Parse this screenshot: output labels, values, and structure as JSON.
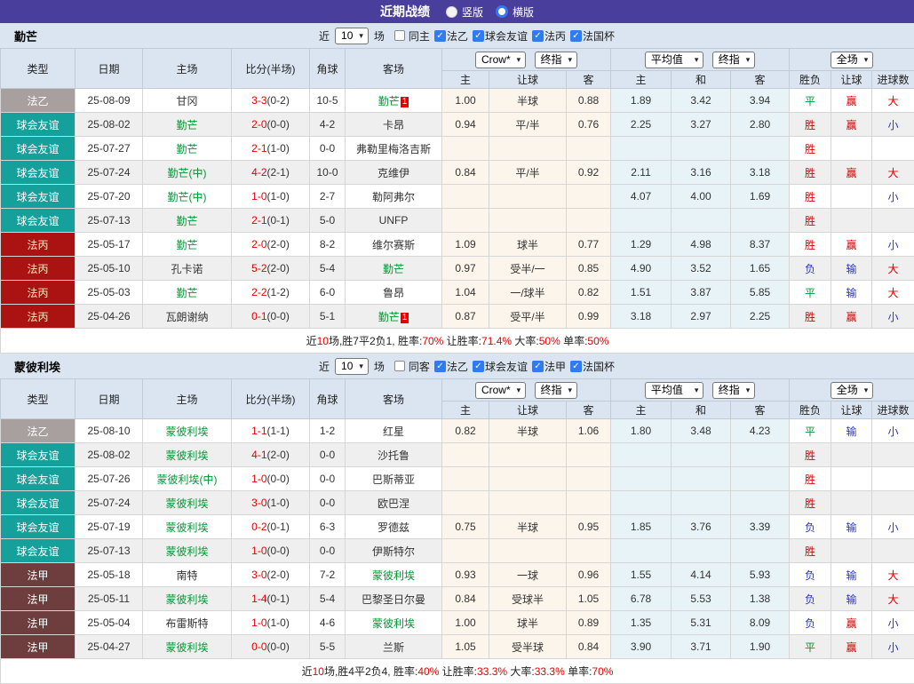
{
  "titlebar": {
    "title": "近期战绩",
    "radios": [
      {
        "label": "竖版",
        "checked": false
      },
      {
        "label": "横版",
        "checked": true
      }
    ]
  },
  "common": {
    "near_label": "近",
    "count_value": "10",
    "matches_label": "场",
    "col_headers": [
      "类型",
      "日期",
      "主场",
      "比分(半场)",
      "角球",
      "客场"
    ],
    "odds_select1": "Crow*",
    "odds_select2": "终指",
    "avg_select1": "平均值",
    "avg_select2": "终指",
    "scope_select": "全场",
    "sub_headers": [
      "主",
      "让球",
      "客",
      "主",
      "和",
      "客",
      "胜负",
      "让球",
      "进球数"
    ]
  },
  "league_colors": {
    "法乙": {
      "bg": "#a89f9f",
      "fg": "#ffffff"
    },
    "球会友谊": {
      "bg": "#16a09c",
      "fg": "#ffffff"
    },
    "法丙": {
      "bg": "#ab1212",
      "fg": "#ffe9c0"
    },
    "法甲": {
      "bg": "#6e3d3d",
      "fg": "#ffffff"
    }
  },
  "sections": [
    {
      "team": "勤芒",
      "same_venue_label": "同主",
      "leagues": [
        "法乙",
        "球会友谊",
        "法丙",
        "法国杯"
      ],
      "rows": [
        {
          "league": "法乙",
          "date": "25-08-09",
          "home": "甘冈",
          "home_green": false,
          "score": "3-3",
          "half": "(0-2)",
          "corner": "10-5",
          "away": "勤芒",
          "away_green": true,
          "away_badge": "1",
          "odds": [
            "1.00",
            "半球",
            "0.88"
          ],
          "avg": [
            "1.89",
            "3.42",
            "3.94"
          ],
          "results": [
            [
              "平",
              "g"
            ],
            [
              "赢",
              "r"
            ],
            [
              "大",
              "r"
            ]
          ]
        },
        {
          "league": "球会友谊",
          "date": "25-08-02",
          "home": "勤芒",
          "home_green": true,
          "score": "2-0",
          "half": "(0-0)",
          "corner": "4-2",
          "away": "卡昂",
          "away_green": false,
          "away_badge": "",
          "odds": [
            "0.94",
            "平/半",
            "0.76"
          ],
          "avg": [
            "2.25",
            "3.27",
            "2.80"
          ],
          "results": [
            [
              "胜",
              "r"
            ],
            [
              "赢",
              "r"
            ],
            [
              "小",
              "b"
            ]
          ]
        },
        {
          "league": "球会友谊",
          "date": "25-07-27",
          "home": "勤芒",
          "home_green": true,
          "score": "2-1",
          "half": "(1-0)",
          "corner": "0-0",
          "away": "弗勒里梅洛吉斯",
          "away_green": false,
          "away_badge": "",
          "odds": [
            "",
            "",
            ""
          ],
          "avg": [
            "",
            "",
            ""
          ],
          "results": [
            [
              "胜",
              "r"
            ],
            [
              "",
              ""
            ],
            [
              "",
              ""
            ]
          ]
        },
        {
          "league": "球会友谊",
          "date": "25-07-24",
          "home": "勤芒(中)",
          "home_green": true,
          "score": "4-2",
          "half": "(2-1)",
          "corner": "10-0",
          "away": "克维伊",
          "away_green": false,
          "away_badge": "",
          "odds": [
            "0.84",
            "平/半",
            "0.92"
          ],
          "avg": [
            "2.11",
            "3.16",
            "3.18"
          ],
          "results": [
            [
              "胜",
              "r"
            ],
            [
              "赢",
              "r"
            ],
            [
              "大",
              "r"
            ]
          ]
        },
        {
          "league": "球会友谊",
          "date": "25-07-20",
          "home": "勤芒(中)",
          "home_green": true,
          "score": "1-0",
          "half": "(1-0)",
          "corner": "2-7",
          "away": "勒阿弗尔",
          "away_green": false,
          "away_badge": "",
          "odds": [
            "",
            "",
            ""
          ],
          "avg": [
            "4.07",
            "4.00",
            "1.69"
          ],
          "results": [
            [
              "胜",
              "r"
            ],
            [
              "",
              ""
            ],
            [
              "小",
              "b"
            ]
          ]
        },
        {
          "league": "球会友谊",
          "date": "25-07-13",
          "home": "勤芒",
          "home_green": true,
          "score": "2-1",
          "half": "(0-1)",
          "corner": "5-0",
          "away": "UNFP",
          "away_green": false,
          "away_badge": "",
          "odds": [
            "",
            "",
            ""
          ],
          "avg": [
            "",
            "",
            ""
          ],
          "results": [
            [
              "胜",
              "r"
            ],
            [
              "",
              ""
            ],
            [
              "",
              ""
            ]
          ]
        },
        {
          "league": "法丙",
          "date": "25-05-17",
          "home": "勤芒",
          "home_green": true,
          "score": "2-0",
          "half": "(2-0)",
          "corner": "8-2",
          "away": "维尔赛斯",
          "away_green": false,
          "away_badge": "",
          "odds": [
            "1.09",
            "球半",
            "0.77"
          ],
          "avg": [
            "1.29",
            "4.98",
            "8.37"
          ],
          "results": [
            [
              "胜",
              "r"
            ],
            [
              "赢",
              "r"
            ],
            [
              "小",
              "b"
            ]
          ]
        },
        {
          "league": "法丙",
          "date": "25-05-10",
          "home": "孔卡诺",
          "home_green": false,
          "score": "5-2",
          "half": "(2-0)",
          "corner": "5-4",
          "away": "勤芒",
          "away_green": true,
          "away_badge": "",
          "odds": [
            "0.97",
            "受半/一",
            "0.85"
          ],
          "avg": [
            "4.90",
            "3.52",
            "1.65"
          ],
          "results": [
            [
              "负",
              "b"
            ],
            [
              "输",
              "b"
            ],
            [
              "大",
              "r"
            ]
          ]
        },
        {
          "league": "法丙",
          "date": "25-05-03",
          "home": "勤芒",
          "home_green": true,
          "score": "2-2",
          "half": "(1-2)",
          "corner": "6-0",
          "away": "鲁昂",
          "away_green": false,
          "away_badge": "",
          "odds": [
            "1.04",
            "一/球半",
            "0.82"
          ],
          "avg": [
            "1.51",
            "3.87",
            "5.85"
          ],
          "results": [
            [
              "平",
              "g"
            ],
            [
              "输",
              "b"
            ],
            [
              "大",
              "r"
            ]
          ]
        },
        {
          "league": "法丙",
          "date": "25-04-26",
          "home": "瓦朗谢纳",
          "home_green": false,
          "score": "0-1",
          "half": "(0-0)",
          "corner": "5-1",
          "away": "勤芒",
          "away_green": true,
          "away_badge": "1",
          "odds": [
            "0.87",
            "受平/半",
            "0.99"
          ],
          "avg": [
            "3.18",
            "2.97",
            "2.25"
          ],
          "results": [
            [
              "胜",
              "r"
            ],
            [
              "赢",
              "r"
            ],
            [
              "小",
              "b"
            ]
          ]
        }
      ],
      "summary": [
        {
          "t": "近",
          "r": false
        },
        {
          "t": "10",
          "r": true
        },
        {
          "t": "场,胜7平2负1, 胜率:",
          "r": false
        },
        {
          "t": "70%",
          "r": true
        },
        {
          "t": " 让胜率:",
          "r": false
        },
        {
          "t": "71.4%",
          "r": true
        },
        {
          "t": " 大率:",
          "r": false
        },
        {
          "t": "50%",
          "r": true
        },
        {
          "t": " 单率:",
          "r": false
        },
        {
          "t": "50%",
          "r": true
        }
      ]
    },
    {
      "team": "蒙彼利埃",
      "same_venue_label": "同客",
      "leagues": [
        "法乙",
        "球会友谊",
        "法甲",
        "法国杯"
      ],
      "rows": [
        {
          "league": "法乙",
          "date": "25-08-10",
          "home": "蒙彼利埃",
          "home_green": true,
          "score": "1-1",
          "half": "(1-1)",
          "corner": "1-2",
          "away": "红星",
          "away_green": false,
          "away_badge": "",
          "odds": [
            "0.82",
            "半球",
            "1.06"
          ],
          "avg": [
            "1.80",
            "3.48",
            "4.23"
          ],
          "results": [
            [
              "平",
              "g"
            ],
            [
              "输",
              "b"
            ],
            [
              "小",
              "b"
            ]
          ]
        },
        {
          "league": "球会友谊",
          "date": "25-08-02",
          "home": "蒙彼利埃",
          "home_green": true,
          "score": "4-1",
          "half": "(2-0)",
          "corner": "0-0",
          "away": "沙托鲁",
          "away_green": false,
          "away_badge": "",
          "odds": [
            "",
            "",
            ""
          ],
          "avg": [
            "",
            "",
            ""
          ],
          "results": [
            [
              "胜",
              "r"
            ],
            [
              "",
              ""
            ],
            [
              "",
              ""
            ]
          ]
        },
        {
          "league": "球会友谊",
          "date": "25-07-26",
          "home": "蒙彼利埃(中)",
          "home_green": true,
          "score": "1-0",
          "half": "(0-0)",
          "corner": "0-0",
          "away": "巴斯蒂亚",
          "away_green": false,
          "away_badge": "",
          "odds": [
            "",
            "",
            ""
          ],
          "avg": [
            "",
            "",
            ""
          ],
          "results": [
            [
              "胜",
              "r"
            ],
            [
              "",
              ""
            ],
            [
              "",
              ""
            ]
          ]
        },
        {
          "league": "球会友谊",
          "date": "25-07-24",
          "home": "蒙彼利埃",
          "home_green": true,
          "score": "3-0",
          "half": "(1-0)",
          "corner": "0-0",
          "away": "欧巴涅",
          "away_green": false,
          "away_badge": "",
          "odds": [
            "",
            "",
            ""
          ],
          "avg": [
            "",
            "",
            ""
          ],
          "results": [
            [
              "胜",
              "r"
            ],
            [
              "",
              ""
            ],
            [
              "",
              ""
            ]
          ]
        },
        {
          "league": "球会友谊",
          "date": "25-07-19",
          "home": "蒙彼利埃",
          "home_green": true,
          "score": "0-2",
          "half": "(0-1)",
          "corner": "6-3",
          "away": "罗德兹",
          "away_green": false,
          "away_badge": "",
          "odds": [
            "0.75",
            "半球",
            "0.95"
          ],
          "avg": [
            "1.85",
            "3.76",
            "3.39"
          ],
          "results": [
            [
              "负",
              "b"
            ],
            [
              "输",
              "b"
            ],
            [
              "小",
              "b"
            ]
          ]
        },
        {
          "league": "球会友谊",
          "date": "25-07-13",
          "home": "蒙彼利埃",
          "home_green": true,
          "score": "1-0",
          "half": "(0-0)",
          "corner": "0-0",
          "away": "伊斯特尔",
          "away_green": false,
          "away_badge": "",
          "odds": [
            "",
            "",
            ""
          ],
          "avg": [
            "",
            "",
            ""
          ],
          "results": [
            [
              "胜",
              "r"
            ],
            [
              "",
              ""
            ],
            [
              "",
              ""
            ]
          ]
        },
        {
          "league": "法甲",
          "date": "25-05-18",
          "home": "南特",
          "home_green": false,
          "score": "3-0",
          "half": "(2-0)",
          "corner": "7-2",
          "away": "蒙彼利埃",
          "away_green": true,
          "away_badge": "",
          "odds": [
            "0.93",
            "一球",
            "0.96"
          ],
          "avg": [
            "1.55",
            "4.14",
            "5.93"
          ],
          "results": [
            [
              "负",
              "b"
            ],
            [
              "输",
              "b"
            ],
            [
              "大",
              "r"
            ]
          ]
        },
        {
          "league": "法甲",
          "date": "25-05-11",
          "home": "蒙彼利埃",
          "home_green": true,
          "score": "1-4",
          "half": "(0-1)",
          "corner": "5-4",
          "away": "巴黎圣日尔曼",
          "away_green": false,
          "away_badge": "",
          "odds": [
            "0.84",
            "受球半",
            "1.05"
          ],
          "avg": [
            "6.78",
            "5.53",
            "1.38"
          ],
          "results": [
            [
              "负",
              "b"
            ],
            [
              "输",
              "b"
            ],
            [
              "大",
              "r"
            ]
          ]
        },
        {
          "league": "法甲",
          "date": "25-05-04",
          "home": "布雷斯特",
          "home_green": false,
          "score": "1-0",
          "half": "(1-0)",
          "corner": "4-6",
          "away": "蒙彼利埃",
          "away_green": true,
          "away_badge": "",
          "odds": [
            "1.00",
            "球半",
            "0.89"
          ],
          "avg": [
            "1.35",
            "5.31",
            "8.09"
          ],
          "results": [
            [
              "负",
              "b"
            ],
            [
              "赢",
              "r"
            ],
            [
              "小",
              "b"
            ]
          ]
        },
        {
          "league": "法甲",
          "date": "25-04-27",
          "home": "蒙彼利埃",
          "home_green": true,
          "score": "0-0",
          "half": "(0-0)",
          "corner": "5-5",
          "away": "兰斯",
          "away_green": false,
          "away_badge": "",
          "odds": [
            "1.05",
            "受半球",
            "0.84"
          ],
          "avg": [
            "3.90",
            "3.71",
            "1.90"
          ],
          "results": [
            [
              "平",
              "g"
            ],
            [
              "赢",
              "r"
            ],
            [
              "小",
              "b"
            ]
          ]
        }
      ],
      "summary": [
        {
          "t": "近",
          "r": false
        },
        {
          "t": "10",
          "r": true
        },
        {
          "t": "场,胜4平2负4, 胜率:",
          "r": false
        },
        {
          "t": "40%",
          "r": true
        },
        {
          "t": " 让胜率:",
          "r": false
        },
        {
          "t": "33.3%",
          "r": true
        },
        {
          "t": " 大率:",
          "r": false
        },
        {
          "t": "33.3%",
          "r": true
        },
        {
          "t": " 单率:",
          "r": false
        },
        {
          "t": "70%",
          "r": true
        }
      ]
    }
  ]
}
